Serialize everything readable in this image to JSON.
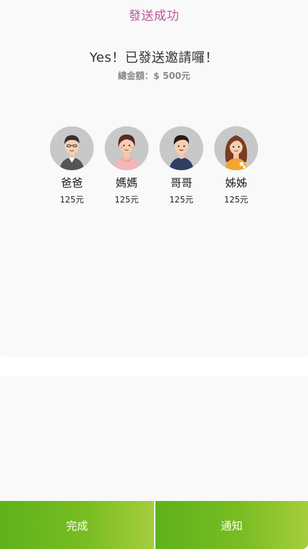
{
  "header": {
    "title": "發送成功"
  },
  "summary": {
    "headline": "Yes！已發送邀請囉！",
    "total": "總金額：$ 500元"
  },
  "family": [
    {
      "name": "爸爸",
      "amount": "125元",
      "avatar": "father-avatar"
    },
    {
      "name": "媽媽",
      "amount": "125元",
      "avatar": "mother-avatar"
    },
    {
      "name": "哥哥",
      "amount": "125元",
      "avatar": "brother-avatar"
    },
    {
      "name": "姊姊",
      "amount": "125元",
      "avatar": "sister-avatar"
    }
  ],
  "actions": {
    "done": "完成",
    "notify": "通知"
  },
  "colors": {
    "title": "#c0569b",
    "button_start": "#5fb21c",
    "button_end": "#a5cd3e",
    "avatar_bg": "#c8c8c8"
  }
}
